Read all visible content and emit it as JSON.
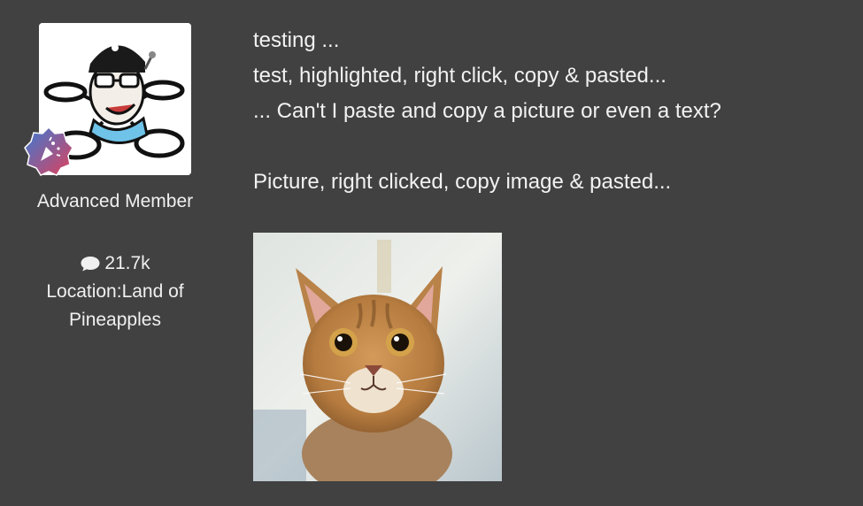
{
  "author": {
    "rank": "Advanced Member",
    "post_count": "21.7k",
    "location_label": "Location:",
    "location_value": "Land of Pineapples"
  },
  "post": {
    "lines": [
      "testing ...",
      "test, highlighted, right click, copy & pasted...",
      "... Can't I paste and copy a picture or even a text?",
      "Picture, right clicked, copy image & pasted..."
    ]
  },
  "icons": {
    "comment": "speech-bubble-icon",
    "badge": "confetti-badge-icon"
  },
  "colors": {
    "background": "#414141",
    "text": "#f2f2f2",
    "badge_gradient_start": "#3a7bd5",
    "badge_gradient_end": "#e0405a"
  }
}
